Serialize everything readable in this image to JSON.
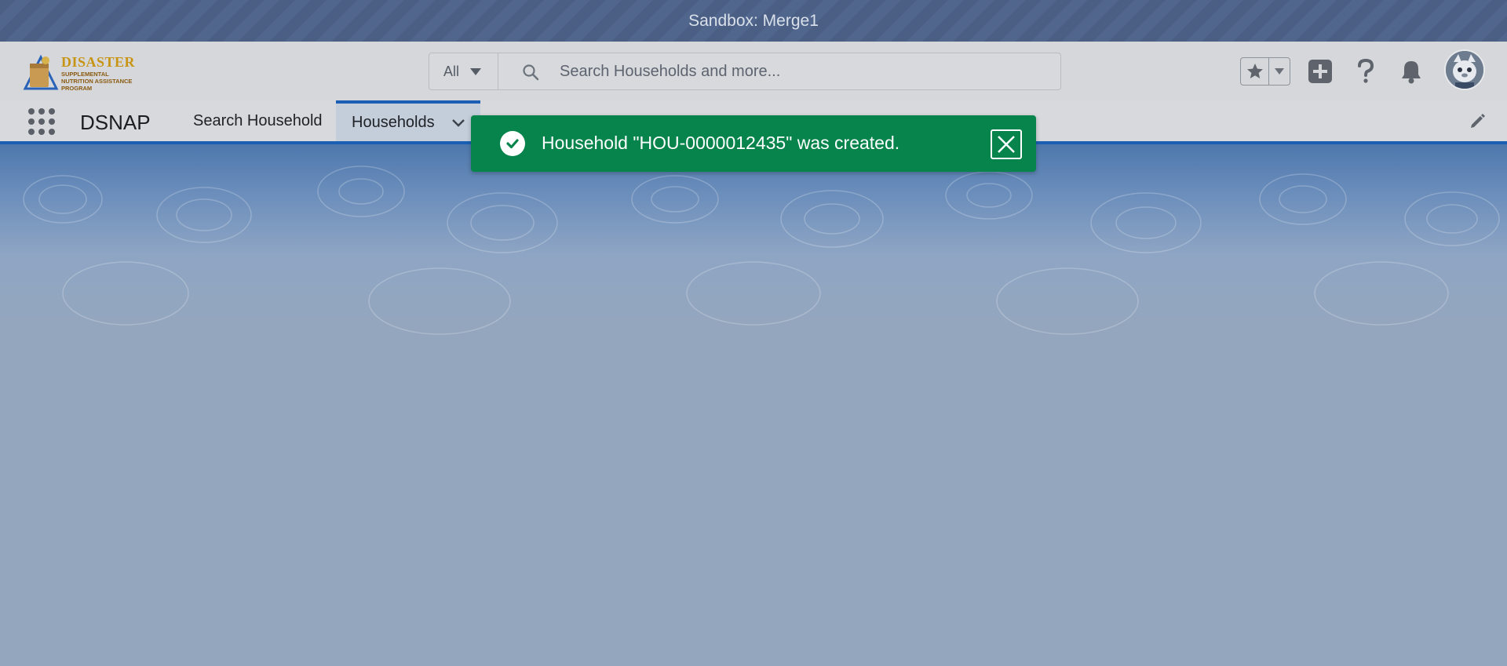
{
  "sandbox": {
    "label": "Sandbox: Merge1"
  },
  "logo": {
    "line1": "DISASTER",
    "line2": "SUPPLEMENTAL NUTRITION ASSISTANCE PROGRAM"
  },
  "search": {
    "scope": "All",
    "placeholder": "Search Households and more..."
  },
  "header_icons": [
    "star-icon",
    "chevron-down-icon",
    "plus-icon",
    "help-icon",
    "bell-icon",
    "avatar"
  ],
  "nav": {
    "app_name": "DSNAP",
    "items": [
      {
        "label": "Search Household"
      },
      {
        "label": "Households",
        "active": true
      }
    ]
  },
  "toast": {
    "message": "Household \"HOU-0000012435\" was created.",
    "type": "success",
    "color": "#06844b"
  },
  "colors": {
    "accent": "#1a5fb4",
    "sandbox_bar": "#4b5f85"
  }
}
